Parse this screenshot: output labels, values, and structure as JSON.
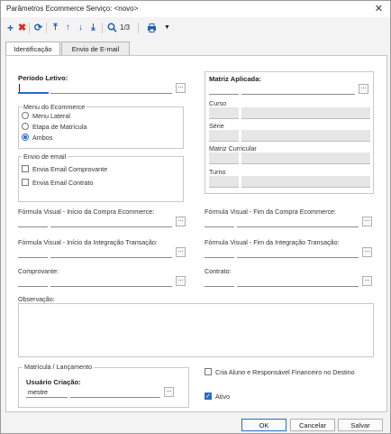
{
  "window": {
    "title": "Parâmetros Ecommerce Serviço: <novo>",
    "close_glyph": "✕"
  },
  "toolbar": {
    "record_position": "1/3"
  },
  "tabs": [
    {
      "label": "Identificação"
    },
    {
      "label": "Envio de E-mail"
    }
  ],
  "form": {
    "periodo_letivo": {
      "label": "Período Letivo:"
    },
    "matriz_aplicada": {
      "label": "Matriz Aplicada:",
      "curso_label": "Curso",
      "serie_label": "Série",
      "matriz_curricular_label": "Matriz Curricular",
      "turno_label": "Turno"
    },
    "menu_ecommerce": {
      "title": "Menu do Ecommerce",
      "options": [
        {
          "label": "Menu Lateral"
        },
        {
          "label": "Etapa de Matrícula"
        },
        {
          "label": "Ambos"
        }
      ]
    },
    "envio_email": {
      "title": "Envio de email",
      "options": [
        {
          "label": "Envia Email Comprovante"
        },
        {
          "label": "Envia Email Contrato"
        }
      ]
    },
    "fv_inicio_compra": {
      "label": "Fórmula Visual - Início da Compra Ecommerce:"
    },
    "fv_fim_compra": {
      "label": "Fórmula Visual - Fim da Compra Ecommerce:"
    },
    "fv_inicio_integracao": {
      "label": "Fórmula Visual - Início da Integração Transação:"
    },
    "fv_fim_integracao": {
      "label": "Fórmula Visual - Fim da Integração Transação:"
    },
    "comprovante": {
      "label": "Comprovante:"
    },
    "contrato": {
      "label": "Contrato:"
    },
    "observacao": {
      "label": "Observação:"
    },
    "matricula": {
      "title": "Matrícula / Lançamento",
      "usuario_label": "Usuário Criação:",
      "usuario_value": "mestre"
    },
    "cria_aluno": {
      "label": "Cria Aluno e Responsável Financeiro no Destino"
    },
    "ativo": {
      "label": "Ativo"
    }
  },
  "footer": {
    "ok": "OK",
    "cancel": "Cancelar",
    "save": "Salvar"
  },
  "ellipsis": "...",
  "colors": {
    "accent": "#2b6cc4",
    "delete": "#d0302b",
    "toolbar_icon": "#1f5fb0"
  }
}
